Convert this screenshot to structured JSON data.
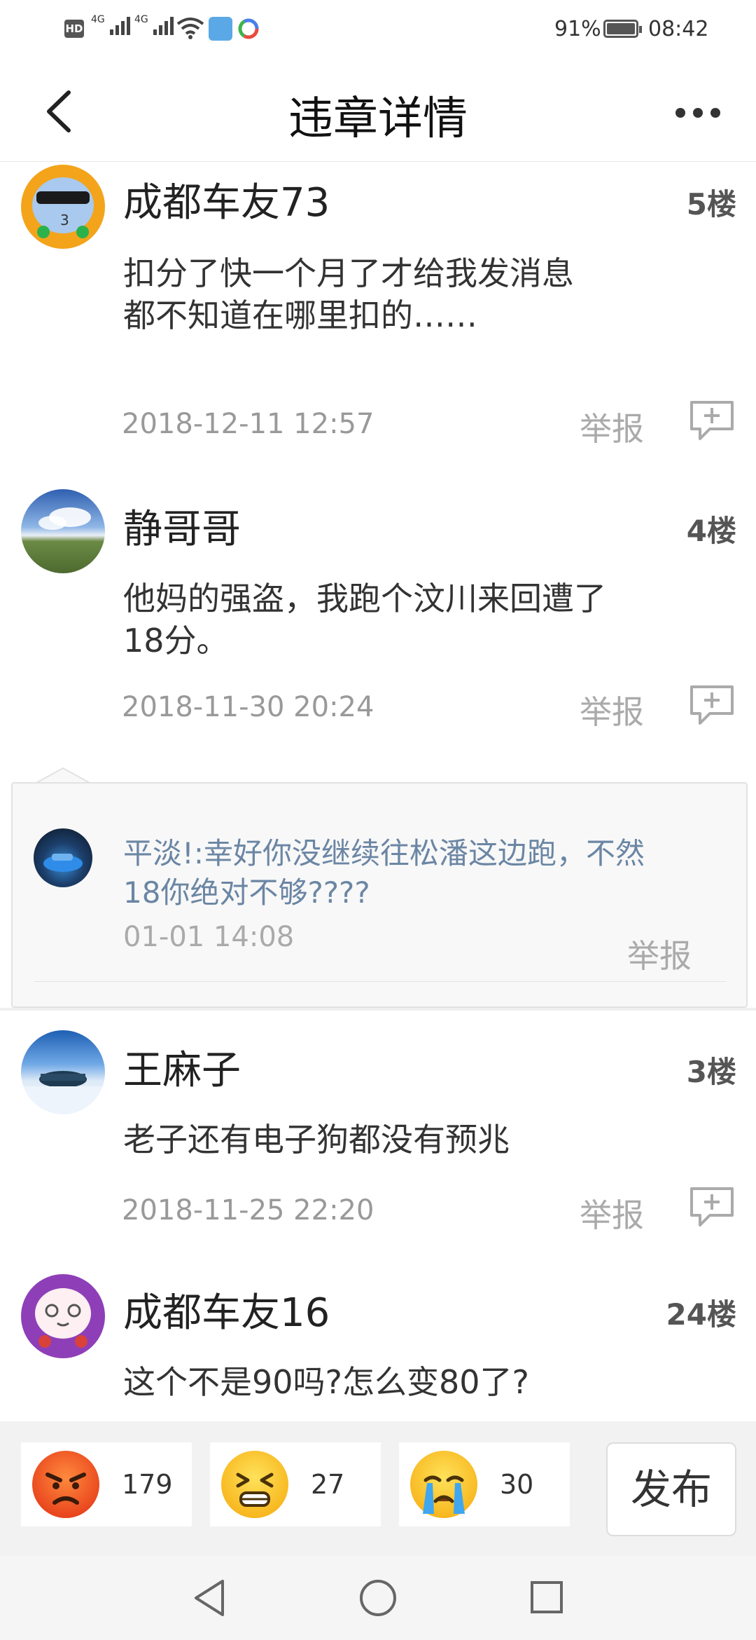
{
  "status_bar": {
    "hd": "HD",
    "net1": "4G",
    "net2": "4G",
    "battery": "91%",
    "time": "08:42"
  },
  "header": {
    "title": "违章详情"
  },
  "comments": [
    {
      "name": "成都车友73",
      "floor": "5楼",
      "content_lines": [
        "扣分了快一个月了才给我发消息",
        "都不知道在哪里扣的……"
      ],
      "time": "2018-12-11  12:57",
      "report": "举报"
    },
    {
      "name": "静哥哥",
      "floor": "4楼",
      "content_lines": [
        "他妈的强盗，我跑个汶川来回遭了",
        "18分。"
      ],
      "time": "2018-11-30  20:24",
      "report": "举报",
      "reply": {
        "lines": [
          "平淡!:幸好你没继续往松潘这边跑，不然",
          "18你绝对不够????"
        ],
        "time": "01-01  14:08",
        "report": "举报"
      }
    },
    {
      "name": "王麻子",
      "floor": "3楼",
      "content_lines": [
        "老子还有电子狗都没有预兆"
      ],
      "time": "2018-11-25  22:20",
      "report": "举报"
    },
    {
      "name": "成都车友16",
      "floor": "24楼",
      "content_lines": [
        "这个不是90吗?怎么变80了?"
      ]
    }
  ],
  "reactions": [
    {
      "icon": "angry-face-icon",
      "count": "179"
    },
    {
      "icon": "frustrated-face-icon",
      "count": "27"
    },
    {
      "icon": "crying-face-icon",
      "count": "30"
    }
  ],
  "publish_label": "发布",
  "colors": {
    "reply_text": "#6b86a4",
    "muted": "#999999",
    "background": "#ffffff",
    "bar_background": "#f2f2f2"
  }
}
